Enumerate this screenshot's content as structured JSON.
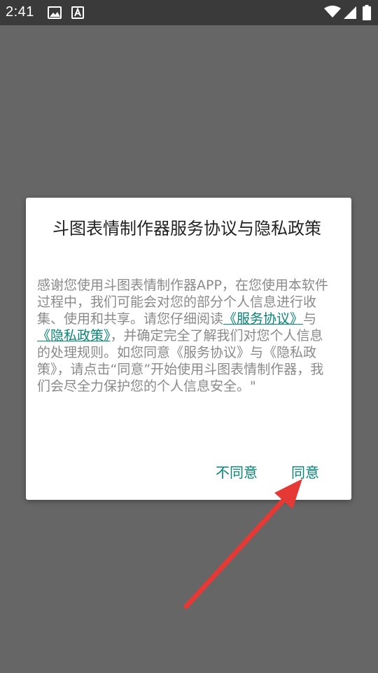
{
  "status_bar": {
    "time": "2:41",
    "icons": [
      "image-icon",
      "font-icon",
      "wifi-icon",
      "signal-icon",
      "battery-icon"
    ]
  },
  "dialog": {
    "title": "斗图表情制作器服务协议与隐私政策",
    "body": {
      "part1": "感谢您使用斗图表情制作器APP，在您使用本软件过程中，我们可能会对您的部分个人信息进行收集、使用和共享。请您仔细阅读",
      "link_service": "《服务协议》",
      "part2": "与",
      "link_privacy": "《隐私政策》",
      "part3": "，并确定完全了解我们对您个人信息的处理规则。如您同意《服务协议》与《隐私政策》，请点击“同意”开始使用斗图表情制作器，我们会尽全力保护您的个人信息安全。\""
    },
    "buttons": {
      "disagree": "不同意",
      "agree": "同意"
    }
  },
  "colors": {
    "accent": "#078577",
    "arrow": "#e53935",
    "overlay": "#666666"
  }
}
